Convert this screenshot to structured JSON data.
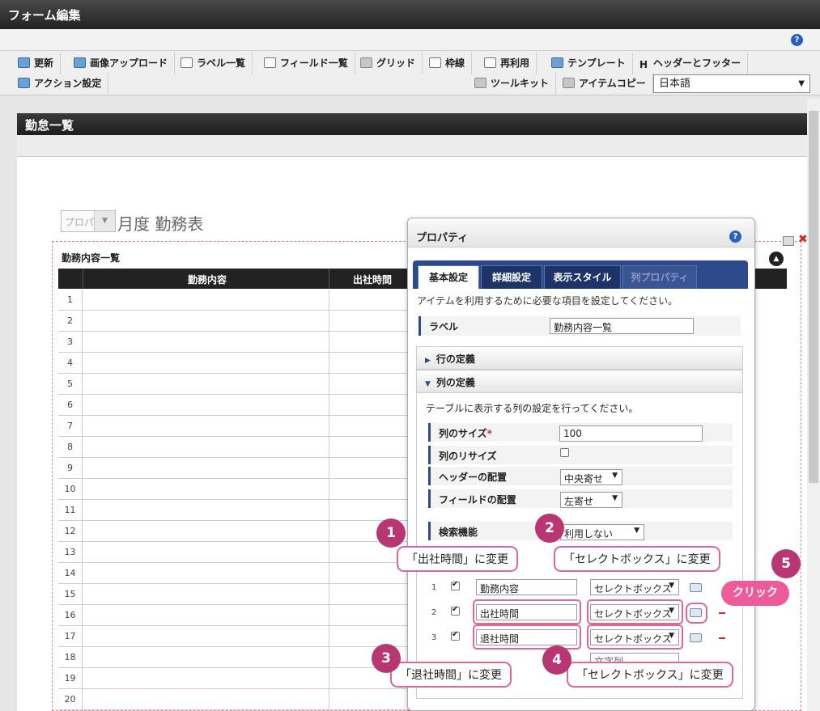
{
  "window": {
    "title": "フォーム編集",
    "help_icon": "?"
  },
  "toolbar": {
    "row1": [
      {
        "label": "更新",
        "icon": "refresh-icon"
      },
      {
        "label": "画像アップロード",
        "icon": "image-upload-icon"
      },
      {
        "label": "ラベル一覧",
        "icon": "label-list-icon"
      },
      {
        "label": "フィールド一覧",
        "icon": "field-list-icon"
      },
      {
        "label": "グリッド",
        "icon": "grid-icon"
      },
      {
        "label": "枠線",
        "icon": "border-icon"
      },
      {
        "label": "再利用",
        "icon": "reuse-icon"
      },
      {
        "label": "テンプレート",
        "icon": "template-icon"
      },
      {
        "label": "ヘッダーとフッター",
        "icon": "header-footer-icon",
        "glyph": "H"
      }
    ],
    "row2": [
      {
        "label": "アクション設定",
        "icon": "action-icon"
      },
      {
        "label": "ツールキット",
        "icon": "toolkit-icon"
      },
      {
        "label": "アイテムコピー",
        "icon": "item-copy-icon"
      }
    ],
    "language": "日本語"
  },
  "form": {
    "header": "勤怠一覧",
    "month_placeholder": "プロパ",
    "month_title": "月度 勤務表",
    "table_title": "勤務内容一覧",
    "columns": [
      "勤務内容",
      "出社時間"
    ],
    "rows": [
      "1",
      "2",
      "3",
      "4",
      "5",
      "6",
      "7",
      "8",
      "9",
      "10",
      "11",
      "12",
      "13",
      "14",
      "15",
      "16",
      "17",
      "18",
      "19",
      "20"
    ]
  },
  "properties": {
    "title": "プロパティ",
    "tabs": [
      "基本設定",
      "詳細設定",
      "表示スタイル",
      "列プロパティ"
    ],
    "description": "アイテムを利用するために必要な項目を設定してください。",
    "label_field": {
      "label": "ラベル",
      "value": "勤務内容一覧"
    },
    "row_def": "行の定義",
    "col_def": "列の定義",
    "col_desc": "テーブルに表示する列の設定を行ってください。",
    "col_size": {
      "label": "列のサイズ",
      "required": "*",
      "value": "100"
    },
    "col_resize": {
      "label": "列のリサイズ"
    },
    "header_align": {
      "label": "ヘッダーの配置",
      "value": "中央寄せ"
    },
    "field_align": {
      "label": "フィールドの配置",
      "value": "左寄せ"
    },
    "search": {
      "label": "検索機能",
      "value": "利用しない"
    },
    "columns": [
      {
        "num": "1",
        "name": "勤務内容",
        "type": "セレクトボックス"
      },
      {
        "num": "2",
        "name": "出社時間",
        "type": "セレクトボックス"
      },
      {
        "num": "3",
        "name": "退社時間",
        "type": "セレクトボックス"
      }
    ],
    "partial_row": {
      "type": "文字列"
    }
  },
  "callouts": [
    {
      "num": "1",
      "text": "「出社時間」に変更"
    },
    {
      "num": "2",
      "text": "「セレクトボックス」に変更"
    },
    {
      "num": "3",
      "text": "「退社時間」に変更"
    },
    {
      "num": "4",
      "text": "「セレクトボックス」に変更"
    },
    {
      "num": "5",
      "text": "クリック"
    }
  ]
}
